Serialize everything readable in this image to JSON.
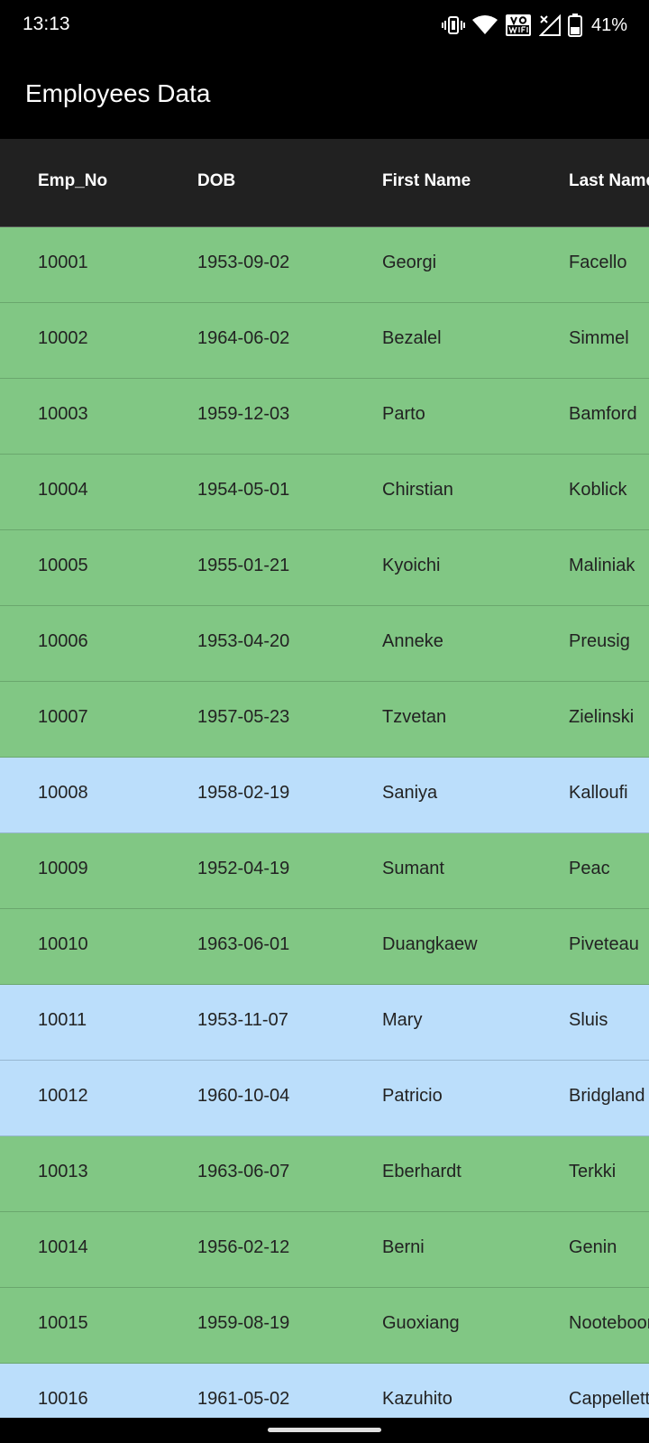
{
  "status_bar": {
    "time": "13:13",
    "battery_percent": "41%",
    "icons": [
      "vibrate-icon",
      "wifi-icon",
      "vowifi-icon",
      "signal-icon",
      "battery-icon"
    ]
  },
  "app_bar": {
    "title": "Employees Data"
  },
  "table": {
    "columns": [
      "Emp_No",
      "DOB",
      "First Name",
      "Last Name"
    ],
    "rows": [
      {
        "emp_no": "10001",
        "dob": "1953-09-02",
        "first_name": "Georgi",
        "last_name": "Facello",
        "color": "green"
      },
      {
        "emp_no": "10002",
        "dob": "1964-06-02",
        "first_name": "Bezalel",
        "last_name": "Simmel",
        "color": "green"
      },
      {
        "emp_no": "10003",
        "dob": "1959-12-03",
        "first_name": "Parto",
        "last_name": "Bamford",
        "color": "green"
      },
      {
        "emp_no": "10004",
        "dob": "1954-05-01",
        "first_name": "Chirstian",
        "last_name": "Koblick",
        "color": "green"
      },
      {
        "emp_no": "10005",
        "dob": "1955-01-21",
        "first_name": "Kyoichi",
        "last_name": "Maliniak",
        "color": "green"
      },
      {
        "emp_no": "10006",
        "dob": "1953-04-20",
        "first_name": "Anneke",
        "last_name": "Preusig",
        "color": "green"
      },
      {
        "emp_no": "10007",
        "dob": "1957-05-23",
        "first_name": "Tzvetan",
        "last_name": "Zielinski",
        "color": "green"
      },
      {
        "emp_no": "10008",
        "dob": "1958-02-19",
        "first_name": "Saniya",
        "last_name": "Kalloufi",
        "color": "blue"
      },
      {
        "emp_no": "10009",
        "dob": "1952-04-19",
        "first_name": "Sumant",
        "last_name": "Peac",
        "color": "green"
      },
      {
        "emp_no": "10010",
        "dob": "1963-06-01",
        "first_name": "Duangkaew",
        "last_name": "Piveteau",
        "color": "green"
      },
      {
        "emp_no": "10011",
        "dob": "1953-11-07",
        "first_name": "Mary",
        "last_name": "Sluis",
        "color": "blue"
      },
      {
        "emp_no": "10012",
        "dob": "1960-10-04",
        "first_name": "Patricio",
        "last_name": "Bridgland",
        "color": "blue"
      },
      {
        "emp_no": "10013",
        "dob": "1963-06-07",
        "first_name": "Eberhardt",
        "last_name": "Terkki",
        "color": "green"
      },
      {
        "emp_no": "10014",
        "dob": "1956-02-12",
        "first_name": "Berni",
        "last_name": "Genin",
        "color": "green"
      },
      {
        "emp_no": "10015",
        "dob": "1959-08-19",
        "first_name": "Guoxiang",
        "last_name": "Nooteboom",
        "color": "green"
      },
      {
        "emp_no": "10016",
        "dob": "1961-05-02",
        "first_name": "Kazuhito",
        "last_name": "Cappelletti",
        "color": "blue"
      }
    ]
  },
  "colors": {
    "header_bg": "#212121",
    "row_green": "#81c784",
    "row_blue": "#bbdefb",
    "app_bar_bg": "#000000"
  }
}
